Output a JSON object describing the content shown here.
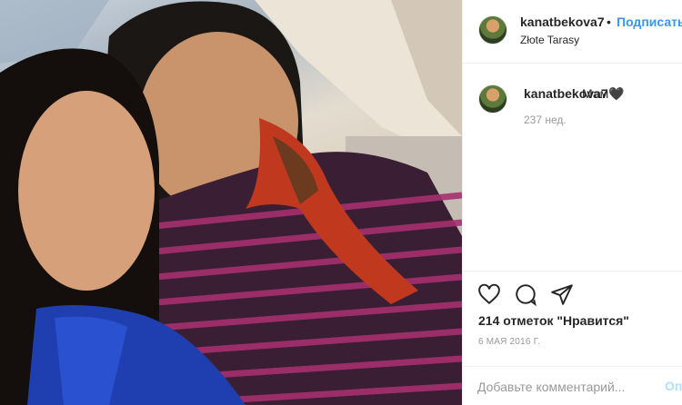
{
  "post": {
    "username": "kanatbekova7",
    "follow_label": "Подписаться",
    "dot": "•",
    "location": "Złote Tarasy"
  },
  "caption": {
    "username": "kanatbekova7",
    "text": "Мам🖤",
    "time": "237 нед."
  },
  "actions": {
    "likes": "214 отметок \"Нравится\"",
    "date": "6 МАЯ 2016 Г."
  },
  "comment_box": {
    "placeholder": "Добавьте комментарий...",
    "post_label": "Оп"
  },
  "icons": {
    "like": "heart-icon",
    "comment": "comment-icon",
    "share": "share-icon"
  }
}
